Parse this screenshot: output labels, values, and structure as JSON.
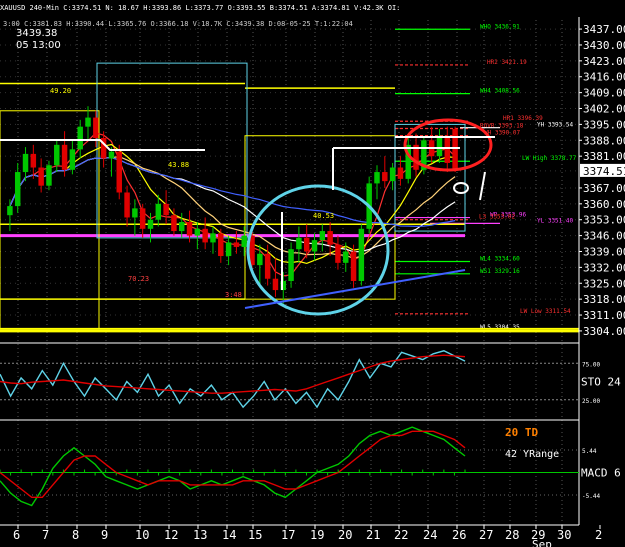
{
  "header": {
    "symbol": "XAUUSD  240-Min",
    "stats": "C:3374.51  N:  18.67  H:3393.86  L:3373.77  O:3393.55  B:3374.51  A:3374.81  V:42.3K  OI:",
    "subline": "3:00  C:3381.83  H:3390.44  L:3365.76  O:3366.18  V:18.7K  C:3439.38  D:08-05-25  T:1:22:04",
    "price": "3439.38",
    "datetime": "05 13:00"
  },
  "colors": {
    "background": "#000000",
    "up": "#00c800",
    "down": "#e00000",
    "grid": "#ffffff",
    "yellow": "#ffff00",
    "cyan": "#5fd3e8",
    "magenta": "#ff40ff",
    "white": "#ffffff"
  },
  "chart_data": [
    {
      "type": "line",
      "title": "",
      "y_ticks": [
        "3437.00",
        "3430.00",
        "3423.00",
        "3416.00",
        "3409.00",
        "3402.00",
        "3395.00",
        "3388.00",
        "3381.00",
        "3374.51",
        "3367.00",
        "3360.00",
        "3353.00",
        "3346.00",
        "3339.00",
        "3332.00",
        "3325.00",
        "3318.00",
        "3311.00",
        "3304.00"
      ],
      "last_price": 3374.51,
      "ylim": [
        3300,
        3441
      ],
      "x_ticks": [
        "6",
        "7",
        "8",
        "9",
        "10",
        "12",
        "13",
        "14",
        "15",
        "17",
        "19",
        "20",
        "21",
        "22",
        "24",
        "26",
        "27",
        "28",
        "29",
        "30",
        "2"
      ],
      "x_month_label": "Sep",
      "candles": [
        {
          "o": 3355,
          "h": 3362,
          "l": 3348,
          "c": 3359
        },
        {
          "o": 3359,
          "h": 3378,
          "l": 3356,
          "c": 3374
        },
        {
          "o": 3374,
          "h": 3385,
          "l": 3370,
          "c": 3382
        },
        {
          "o": 3382,
          "h": 3386,
          "l": 3371,
          "c": 3376
        },
        {
          "o": 3376,
          "h": 3380,
          "l": 3365,
          "c": 3368
        },
        {
          "o": 3368,
          "h": 3379,
          "l": 3366,
          "c": 3377
        },
        {
          "o": 3377,
          "h": 3388,
          "l": 3374,
          "c": 3386
        },
        {
          "o": 3386,
          "h": 3392,
          "l": 3372,
          "c": 3375
        },
        {
          "o": 3375,
          "h": 3388,
          "l": 3373,
          "c": 3384
        },
        {
          "o": 3384,
          "h": 3397,
          "l": 3380,
          "c": 3394
        },
        {
          "o": 3394,
          "h": 3403,
          "l": 3388,
          "c": 3398
        },
        {
          "o": 3398,
          "h": 3401,
          "l": 3385,
          "c": 3389
        },
        {
          "o": 3389,
          "h": 3392,
          "l": 3376,
          "c": 3380
        },
        {
          "o": 3380,
          "h": 3385,
          "l": 3372,
          "c": 3383
        },
        {
          "o": 3383,
          "h": 3386,
          "l": 3362,
          "c": 3365
        },
        {
          "o": 3365,
          "h": 3368,
          "l": 3350,
          "c": 3354
        },
        {
          "o": 3354,
          "h": 3362,
          "l": 3346,
          "c": 3358
        },
        {
          "o": 3358,
          "h": 3360,
          "l": 3345,
          "c": 3349
        },
        {
          "o": 3349,
          "h": 3356,
          "l": 3343,
          "c": 3353
        },
        {
          "o": 3353,
          "h": 3364,
          "l": 3350,
          "c": 3360
        },
        {
          "o": 3360,
          "h": 3366,
          "l": 3351,
          "c": 3355
        },
        {
          "o": 3355,
          "h": 3358,
          "l": 3346,
          "c": 3348
        },
        {
          "o": 3348,
          "h": 3356,
          "l": 3345,
          "c": 3352
        },
        {
          "o": 3352,
          "h": 3357,
          "l": 3343,
          "c": 3346
        },
        {
          "o": 3346,
          "h": 3352,
          "l": 3340,
          "c": 3349
        },
        {
          "o": 3349,
          "h": 3354,
          "l": 3340,
          "c": 3343
        },
        {
          "o": 3343,
          "h": 3350,
          "l": 3338,
          "c": 3347
        },
        {
          "o": 3347,
          "h": 3349,
          "l": 3334,
          "c": 3337
        },
        {
          "o": 3337,
          "h": 3346,
          "l": 3333,
          "c": 3343
        },
        {
          "o": 3343,
          "h": 3348,
          "l": 3338,
          "c": 3341
        },
        {
          "o": 3341,
          "h": 3350,
          "l": 3337,
          "c": 3346
        },
        {
          "o": 3346,
          "h": 3350,
          "l": 3330,
          "c": 3333
        },
        {
          "o": 3333,
          "h": 3342,
          "l": 3325,
          "c": 3338
        },
        {
          "o": 3338,
          "h": 3342,
          "l": 3324,
          "c": 3327
        },
        {
          "o": 3327,
          "h": 3336,
          "l": 3319,
          "c": 3322
        },
        {
          "o": 3322,
          "h": 3330,
          "l": 3316,
          "c": 3326
        },
        {
          "o": 3326,
          "h": 3343,
          "l": 3323,
          "c": 3340
        },
        {
          "o": 3340,
          "h": 3350,
          "l": 3334,
          "c": 3345
        },
        {
          "o": 3345,
          "h": 3351,
          "l": 3336,
          "c": 3339
        },
        {
          "o": 3339,
          "h": 3347,
          "l": 3335,
          "c": 3344
        },
        {
          "o": 3344,
          "h": 3351,
          "l": 3339,
          "c": 3348
        },
        {
          "o": 3348,
          "h": 3352,
          "l": 3337,
          "c": 3342
        },
        {
          "o": 3342,
          "h": 3346,
          "l": 3331,
          "c": 3334
        },
        {
          "o": 3334,
          "h": 3343,
          "l": 3330,
          "c": 3339
        },
        {
          "o": 3339,
          "h": 3342,
          "l": 3323,
          "c": 3326
        },
        {
          "o": 3326,
          "h": 3351,
          "l": 3324,
          "c": 3349
        },
        {
          "o": 3349,
          "h": 3372,
          "l": 3347,
          "c": 3369
        },
        {
          "o": 3369,
          "h": 3377,
          "l": 3362,
          "c": 3374
        },
        {
          "o": 3374,
          "h": 3381,
          "l": 3367,
          "c": 3370
        },
        {
          "o": 3370,
          "h": 3378,
          "l": 3366,
          "c": 3376
        },
        {
          "o": 3376,
          "h": 3381,
          "l": 3368,
          "c": 3371
        },
        {
          "o": 3371,
          "h": 3389,
          "l": 3369,
          "c": 3386
        },
        {
          "o": 3386,
          "h": 3391,
          "l": 3372,
          "c": 3375
        },
        {
          "o": 3375,
          "h": 3390,
          "l": 3373,
          "c": 3388
        },
        {
          "o": 3388,
          "h": 3394,
          "l": 3378,
          "c": 3381
        },
        {
          "o": 3381,
          "h": 3393,
          "l": 3378,
          "c": 3390
        },
        {
          "o": 3390,
          "h": 3394,
          "l": 3374,
          "c": 3378
        },
        {
          "o": 3393,
          "h": 3394,
          "l": 3374,
          "c": 3375
        }
      ],
      "levels": [
        {
          "label": "WHO 3436.91",
          "value": 3436.91,
          "color": "#00ff00"
        },
        {
          "label": "HR2 3421.19",
          "value": 3421.19,
          "color": "#ff3030"
        },
        {
          "label": "WH4 3408.56",
          "value": 3408.56,
          "color": "#00ff00"
        },
        {
          "label": "HR1 3396.39",
          "value": 3396.39,
          "color": "#ff3030"
        },
        {
          "label": "ROVR 3393.18",
          "value": 3393.18,
          "color": "#ff3030"
        },
        {
          "label": "YH 3393.54",
          "value": 3393.54,
          "color": "#ffffff"
        },
        {
          "label": "WH 3390.07",
          "value": 3390.07,
          "color": "#ff3030"
        },
        {
          "label": "LW High 3378.77",
          "value": 3378.77,
          "color": "#00ff00"
        },
        {
          "label": "WP 3353.96",
          "value": 3353.96,
          "color": "#ff40ff"
        },
        {
          "label": "L3 3353.02",
          "value": 3353.02,
          "color": "#ff3030"
        },
        {
          "label": "YL 3351.40",
          "value": 3351.4,
          "color": "#ff40ff"
        },
        {
          "label": "WL4 3334.60",
          "value": 3334.6,
          "color": "#00ff00"
        },
        {
          "label": "WS1 3329.16",
          "value": 3329.16,
          "color": "#00ff00"
        },
        {
          "label": "LW Low 3311.54",
          "value": 3311.54,
          "color": "#ff3030"
        },
        {
          "label": "WL5 3304.35",
          "value": 3304.35,
          "color": "#ffffff"
        }
      ],
      "annotations": [
        "49.20",
        "43.88",
        "40.53",
        "70.23",
        "3:48"
      ]
    },
    {
      "type": "line",
      "title": "STO",
      "label": "STO  24",
      "y_ticks": [
        "75.00",
        "25.00"
      ],
      "ylim": [
        0,
        100
      ],
      "series": [
        {
          "name": "",
          "values": [
            60,
            30,
            55,
            40,
            65,
            45,
            75,
            50,
            30,
            55,
            40,
            25,
            50,
            35,
            60,
            30,
            45,
            20,
            40,
            30,
            45,
            25,
            35,
            15,
            30,
            50,
            25,
            40,
            20,
            35,
            15,
            40,
            25,
            50,
            80,
            55,
            75,
            70,
            90,
            85,
            80,
            88,
            92,
            85,
            78
          ]
        },
        {
          "name": "",
          "values": [
            50,
            48,
            47,
            49,
            50,
            51,
            52,
            50,
            48,
            46,
            44,
            43,
            42,
            41,
            40,
            39,
            38,
            37,
            36,
            35,
            34,
            34,
            35,
            36,
            37,
            38,
            39,
            38,
            37,
            40,
            45,
            50,
            55,
            60,
            65,
            70,
            75,
            78,
            80,
            82,
            84,
            85,
            86,
            85,
            84
          ]
        }
      ]
    },
    {
      "type": "line",
      "title": "MACD",
      "label": "MACD 6",
      "info_labels": [
        "20 TD",
        "42 YRange"
      ],
      "y_ticks": [
        "5.44",
        "-5.44"
      ],
      "ylim": [
        -12,
        12
      ],
      "series": [
        {
          "name": "",
          "values": [
            -2,
            -5,
            -7,
            -8,
            -4,
            1,
            4,
            6,
            4,
            2,
            -1,
            -2,
            -3,
            -4,
            -3,
            -2,
            -1,
            -2,
            -4,
            -3,
            -2,
            -3,
            -2,
            -1,
            -2,
            -3,
            -5,
            -6,
            -4,
            -2,
            0,
            1,
            2,
            4,
            7,
            9,
            10,
            9,
            10,
            11,
            10,
            9,
            8,
            6,
            4
          ]
        },
        {
          "name": "",
          "values": [
            0,
            -2,
            -4,
            -6,
            -6,
            -3,
            0,
            3,
            4,
            4,
            2,
            0,
            -1,
            -2,
            -3,
            -2,
            -2,
            -2,
            -3,
            -3,
            -3,
            -3,
            -3,
            -2,
            -2,
            -2,
            -3,
            -4,
            -4,
            -3,
            -2,
            -1,
            0,
            2,
            4,
            6,
            8,
            9,
            9,
            10,
            10,
            10,
            9,
            8,
            6
          ]
        }
      ]
    }
  ]
}
